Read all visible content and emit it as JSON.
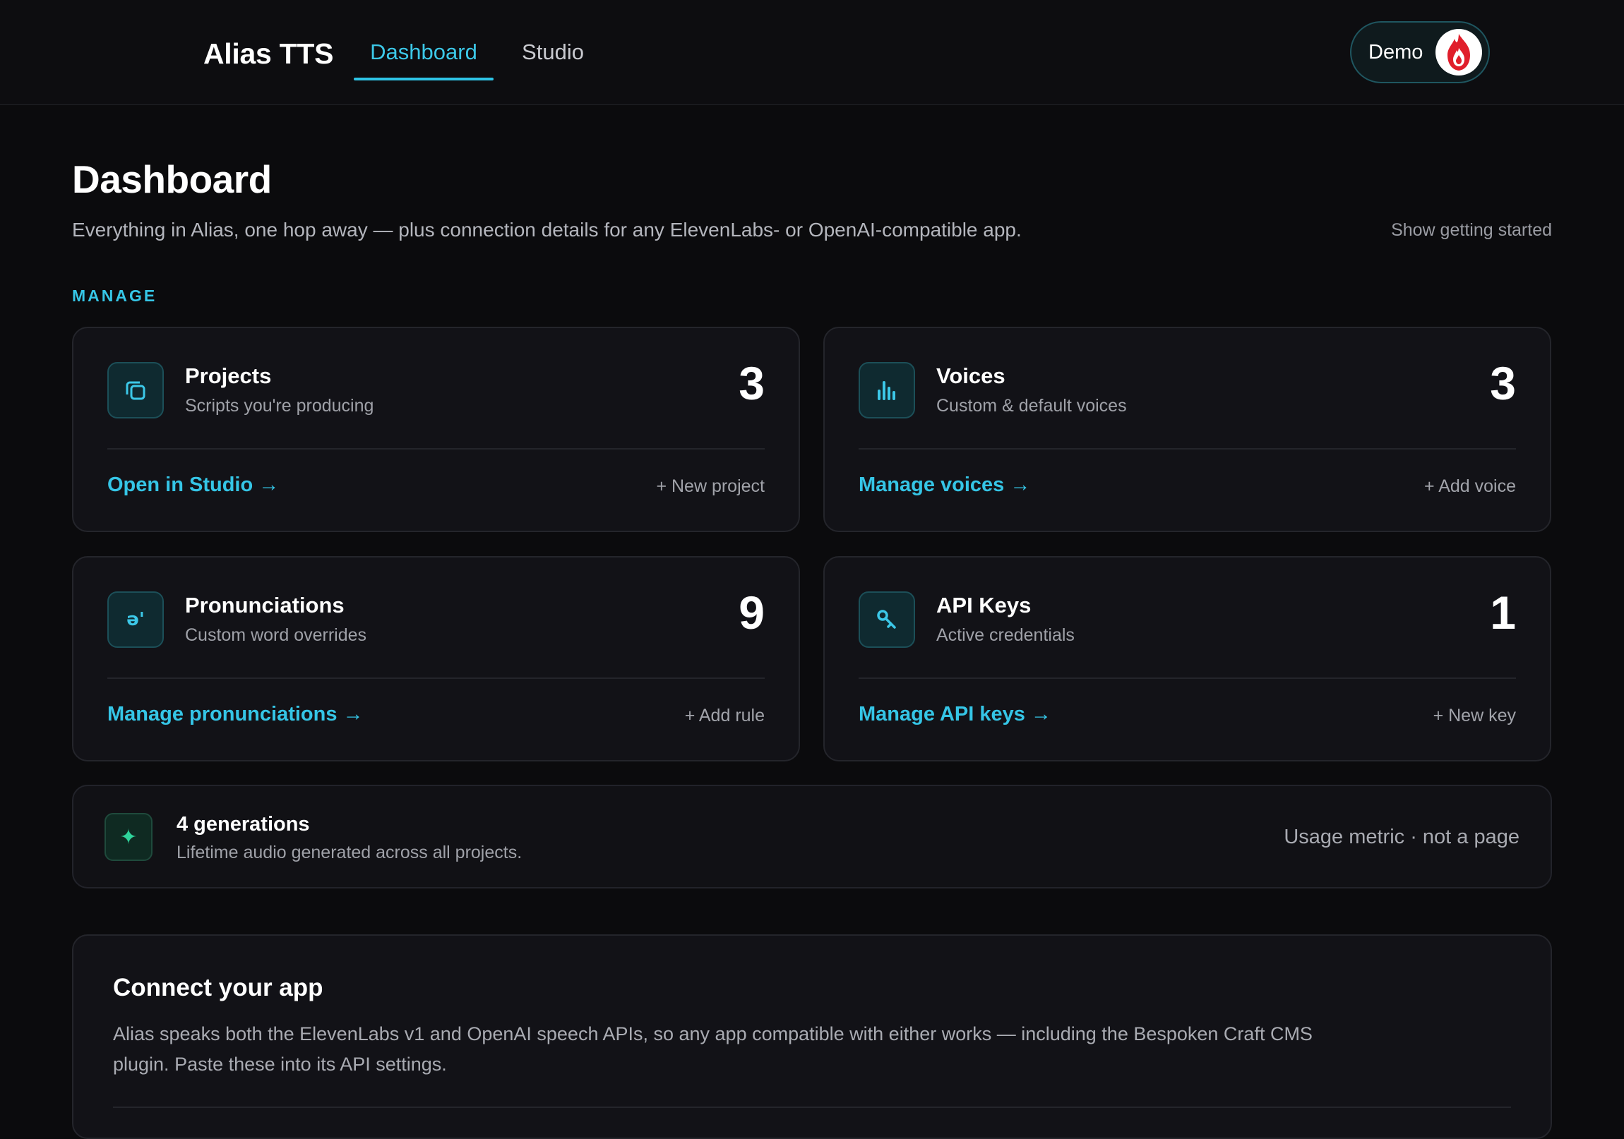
{
  "app": {
    "name": "Alias TTS",
    "logo_icon": "audio-wave-icon",
    "accent": "#2ec4e6"
  },
  "nav": {
    "tabs": [
      {
        "label": "Dashboard",
        "active": true
      },
      {
        "label": "Studio",
        "active": false
      }
    ]
  },
  "user": {
    "name": "Demo",
    "avatar_icon": "flame-logo-icon"
  },
  "page": {
    "title": "Dashboard",
    "subtitle": "Everything in Alias, one hop away — plus connection details for any ElevenLabs- or OpenAI-compatible app.",
    "getting_started": "Show getting started",
    "section_label": "MANAGE"
  },
  "cards": [
    {
      "title": "Projects",
      "desc": "Scripts you're producing",
      "count": "3",
      "link": "Open in Studio →",
      "action": "+ New project",
      "icon": "copy-icon"
    },
    {
      "title": "Voices",
      "desc": "Custom & default voices",
      "count": "3",
      "link": "Manage voices →",
      "action": "+ Add voice",
      "icon": "bar-chart-icon"
    },
    {
      "title": "Pronunciations",
      "desc": "Custom word overrides",
      "count": "9",
      "link": "Manage pronunciations →",
      "action": "+ Add rule",
      "icon": "phonetic-icon",
      "icon_text": "ə'"
    },
    {
      "title": "API Keys",
      "desc": "Active credentials",
      "count": "1",
      "link": "Manage API keys →",
      "action": "+ New key",
      "icon": "key-icon"
    }
  ],
  "usage": {
    "title": "4 generations",
    "desc": "Lifetime audio generated across all projects.",
    "meta": "Usage metric · not a page",
    "icon": "sparkle-icon",
    "icon_text": "✦"
  },
  "connect": {
    "title": "Connect your app",
    "desc": "Alias speaks both the ElevenLabs v1 and OpenAI speech APIs, so any app compatible with either works — including the Bespoken Craft CMS plugin. Paste these into its API settings."
  }
}
